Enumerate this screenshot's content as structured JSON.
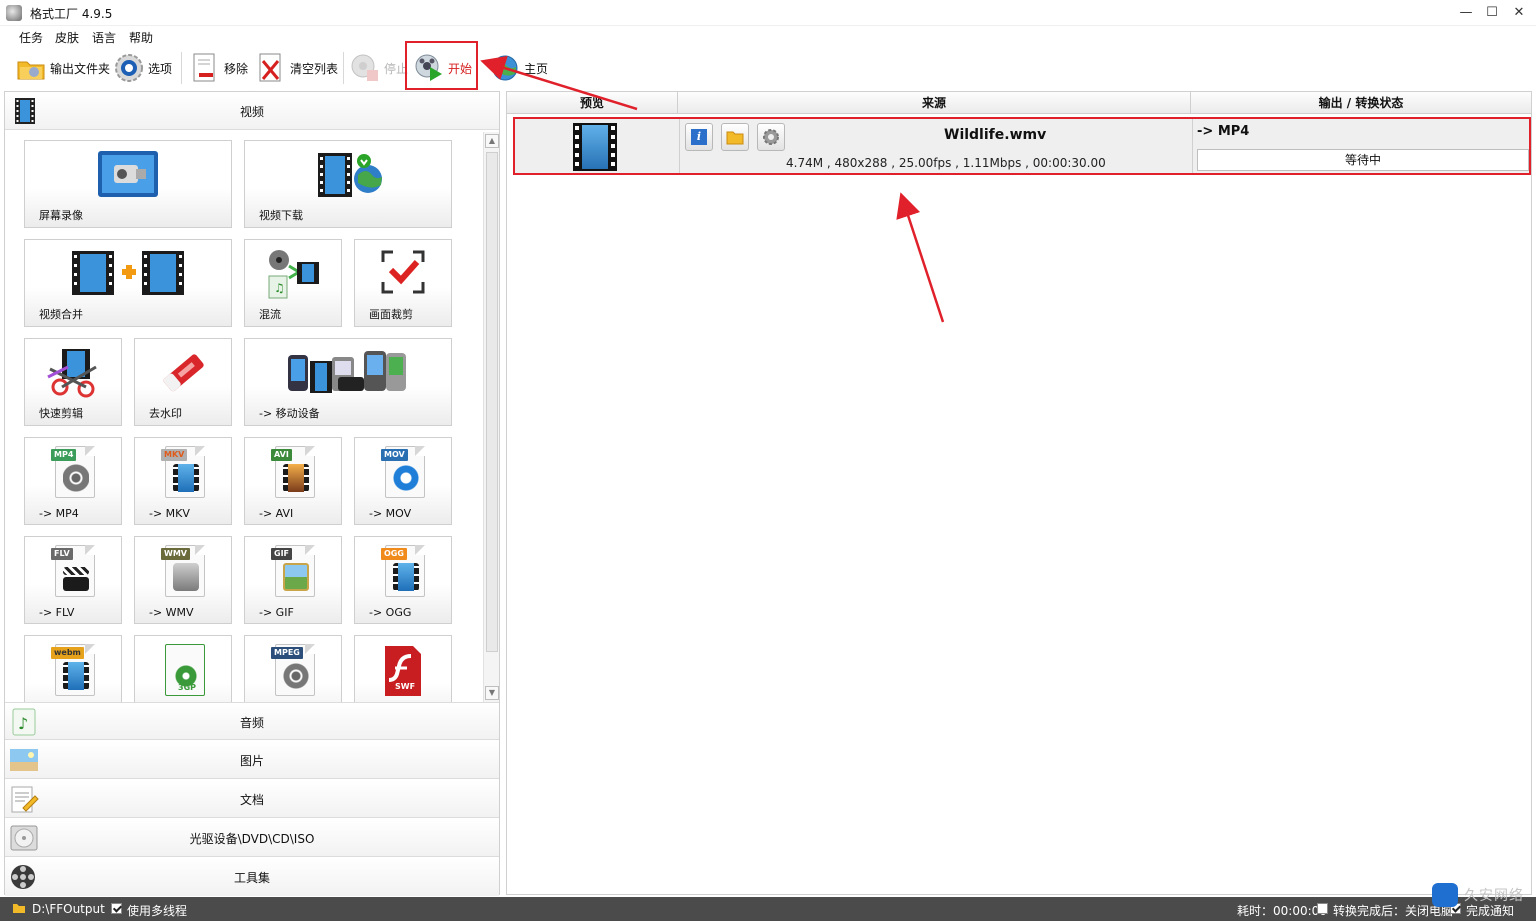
{
  "window": {
    "title": "格式工厂 4.9.5",
    "minimize": "—",
    "maximize": "☐",
    "close": "✕"
  },
  "menu": [
    "任务",
    "皮肤",
    "语言",
    "帮助"
  ],
  "toolbar": {
    "output_folder": "输出文件夹",
    "options": "选项",
    "remove": "移除",
    "clear_list": "清空列表",
    "stop": "停止",
    "start": "开始",
    "home": "主页"
  },
  "left": {
    "video_header": "视频",
    "tiles": {
      "screen_record": "屏幕录像",
      "video_download": "视频下载",
      "video_merge": "视频合并",
      "mux": "混流",
      "crop": "画面裁剪",
      "quick_clip": "快速剪辑",
      "remove_watermark": "去水印",
      "mobile": "-> 移动设备",
      "mp4": "-> MP4",
      "mkv": "-> MKV",
      "avi": "-> AVI",
      "mov": "-> MOV",
      "flv": "-> FLV",
      "wmv": "-> WMV",
      "gif": "-> GIF",
      "ogg": "-> OGG"
    },
    "badges": {
      "mp4": "MP4",
      "mkv": "MKV",
      "avi": "AVI",
      "mov": "MOV",
      "flv": "FLV",
      "wmv": "WMV",
      "gif": "GIF",
      "ogg": "OGG",
      "webm": "webm",
      "mpeg": "MPEG",
      "swf": "SWF",
      "3gp": "3GP"
    },
    "categories": {
      "audio": "音频",
      "image": "图片",
      "document": "文档",
      "optical": "光驱设备\\DVD\\CD\\ISO",
      "tools": "工具集"
    }
  },
  "grid": {
    "columns": [
      "预览",
      "来源",
      "输出 / 转换状态"
    ],
    "task": {
      "filename": "Wildlife.wmv",
      "details": "4.74M , 480x288 , 25.00fps , 1.11Mbps , 00:00:30.00",
      "output": "-> MP4",
      "status": "等待中"
    }
  },
  "statusbar": {
    "output_path": "D:\\FFOutput",
    "multithread": "使用多线程",
    "elapsed": "耗时：00:00:00",
    "after_done": "转换完成后：关闭电脑",
    "notify": "完成通知"
  },
  "watermark": "久安网络",
  "colors": {
    "highlight": "#e0202a",
    "statusbar_bg": "#4b4b4b",
    "film_blue": "#1e6fb8"
  }
}
